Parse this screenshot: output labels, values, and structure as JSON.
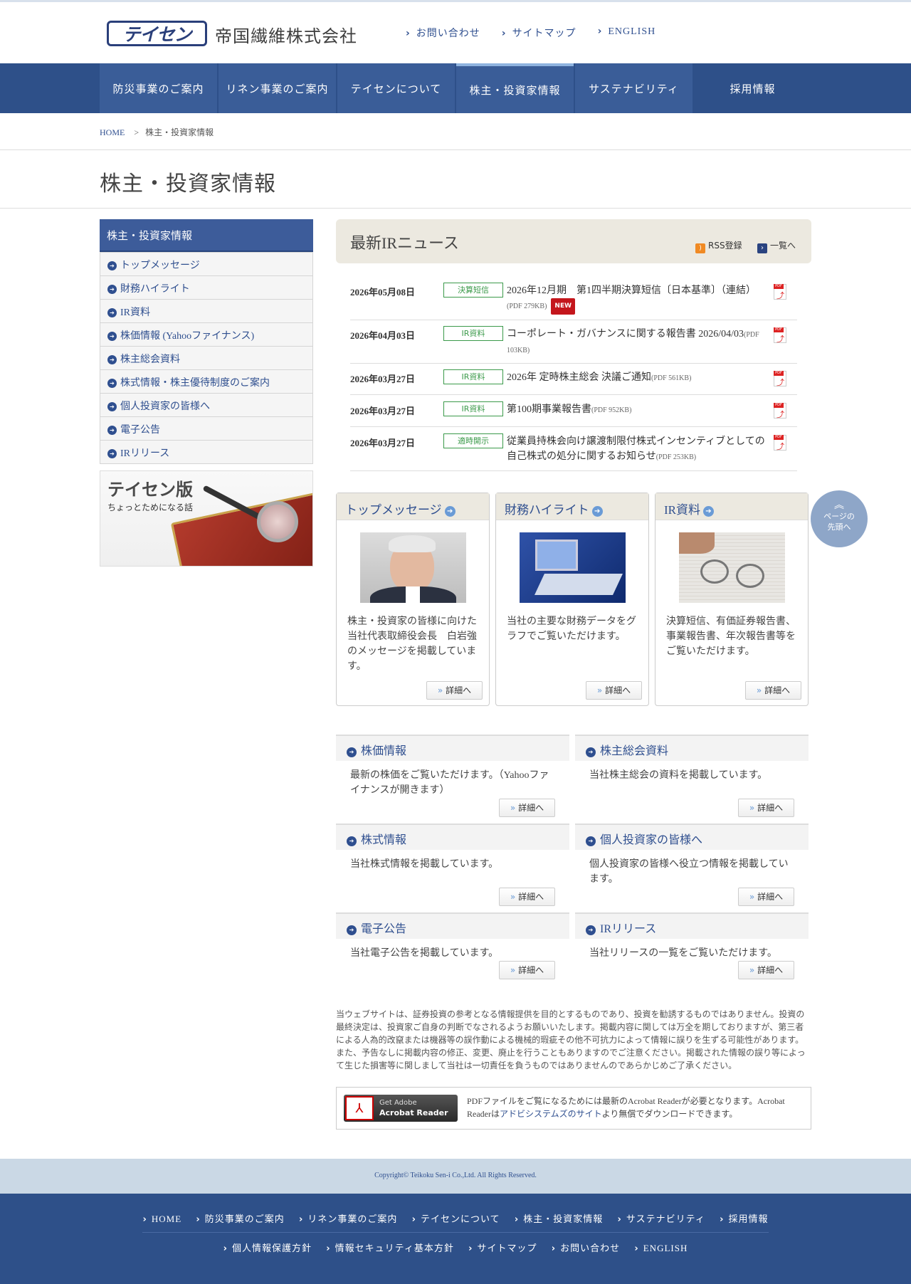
{
  "header": {
    "logo_mark": "テイセン",
    "company_name": "帝国繊維株式会社",
    "links": [
      "お問い合わせ",
      "サイトマップ",
      "ENGLISH"
    ]
  },
  "nav": {
    "items": [
      "防災事業のご案内",
      "リネン事業のご案内",
      "テイセンについて",
      "株主・投資家情報",
      "サステナビリティ",
      "採用情報"
    ],
    "active": "株主・投資家情報"
  },
  "breadcrumb": {
    "home": "HOME",
    "separator": ">",
    "current": "株主・投資家情報"
  },
  "page_title": "株主・投資家情報",
  "sidebar": {
    "heading": "株主・投資家情報",
    "items": [
      "トップメッセージ",
      "財務ハイライト",
      "IR資料",
      "株価情報 (Yahooファイナンス)",
      "株主総会資料",
      "株式情報・株主優待制度のご案内",
      "個人投資家の皆様へ",
      "電子公告",
      "IRリリース"
    ],
    "banner_title": "テイセン版",
    "banner_sub": "ちょっとためになる話"
  },
  "news": {
    "title": "最新IRニュース",
    "rss_label": "RSS登録",
    "list_label": "一覧へ",
    "items": [
      {
        "date": "2026年05月08日",
        "tag": "決算短信",
        "title": "2026年12月期　第1四半期決算短信〔日本基準〕（連結）",
        "size": "(PDF 279KB)",
        "new": "NEW"
      },
      {
        "date": "2026年04月03日",
        "tag": "IR資料",
        "title": "コーポレート・ガバナンスに関する報告書 2026/04/03",
        "size": "(PDF 103KB)",
        "new": ""
      },
      {
        "date": "2026年03月27日",
        "tag": "IR資料",
        "title": "2026年 定時株主総会 決議ご通知",
        "size": "(PDF 561KB)",
        "new": ""
      },
      {
        "date": "2026年03月27日",
        "tag": "IR資料",
        "title": "第100期事業報告書",
        "size": "(PDF 952KB)",
        "new": ""
      },
      {
        "date": "2026年03月27日",
        "tag": "適時開示",
        "title": "従業員持株会向け譲渡制限付株式インセンティブとしての自己株式の処分に関するお知らせ",
        "size": "(PDF 253KB)",
        "new": ""
      }
    ]
  },
  "cards": [
    {
      "title": "トップメッセージ",
      "text": "株主・投資家の皆様に向けた当社代表取締役会長　白岩強のメッセージを掲載しています。",
      "button": "詳細へ"
    },
    {
      "title": "財務ハイライト",
      "text": "当社の主要な財務データをグラフでご覧いただけます。",
      "button": "詳細へ"
    },
    {
      "title": "IR資料",
      "text": "決算短信、有価証券報告書、事業報告書、年次報告書等をご覧いただけます。",
      "button": "詳細へ"
    }
  ],
  "link_boxes": [
    {
      "title": "株価情報",
      "text": "最新の株価をご覧いただけます。（Yahooファイナンスが開きます）",
      "button": "詳細へ"
    },
    {
      "title": "株主総会資料",
      "text": "当社株主総会の資料を掲載しています。",
      "button": "詳細へ"
    },
    {
      "title": "株式情報",
      "text": "当社株式情報を掲載しています。",
      "button": "詳細へ"
    },
    {
      "title": "個人投資家の皆様へ",
      "text": "個人投資家の皆様へ役立つ情報を掲載しています。",
      "button": "詳細へ"
    },
    {
      "title": "電子公告",
      "text": "当社電子公告を掲載しています。",
      "button": "詳細へ"
    },
    {
      "title": "IRリリース",
      "text": "当社リリースの一覧をご覧いただけます。",
      "button": "詳細へ"
    }
  ],
  "disclaimer": "当ウェブサイトは、証券投資の参考となる情報提供を目的とするものであり、投資を勧誘するものではありません。投資の最終決定は、投資家ご自身の判断でなされるようお願いいたします。掲載内容に関しては万全を期しておりますが、第三者による人為的改竄または機器等の誤作動による機械的瑕疵その他不可抗力によって情報に誤りを生ずる可能性があります。また、予告なしに掲載内容の修正、変更、廃止を行うこともありますのでご注意ください。掲載された情報の誤り等によって生じた損害等に関しまして当社は一切責任を負うものではありませんのであらかじめご了承ください。",
  "acrobat": {
    "button_line1": "Get Adobe",
    "button_line2": "Acrobat Reader",
    "text_before": "PDFファイルをご覧になるためには最新のAcrobat Readerが必要となります。Acrobat Readerは",
    "link": "アドビシステムズのサイト",
    "text_after": "より無償でダウンロードできます。"
  },
  "to_top": {
    "line1": "ページの",
    "line2": "先頭へ"
  },
  "footer": {
    "copyright": "Copyright© Teikoku Sen-i Co.,Ltd. All Rights Reserved.",
    "row1": [
      "HOME",
      "防災事業のご案内",
      "リネン事業のご案内",
      "テイセンについて",
      "株主・投資家情報",
      "サステナビリティ",
      "採用情報"
    ],
    "row2": [
      "個人情報保護方針",
      "情報セキュリティ基本方針",
      "サイトマップ",
      "お問い合わせ",
      "ENGLISH"
    ]
  }
}
